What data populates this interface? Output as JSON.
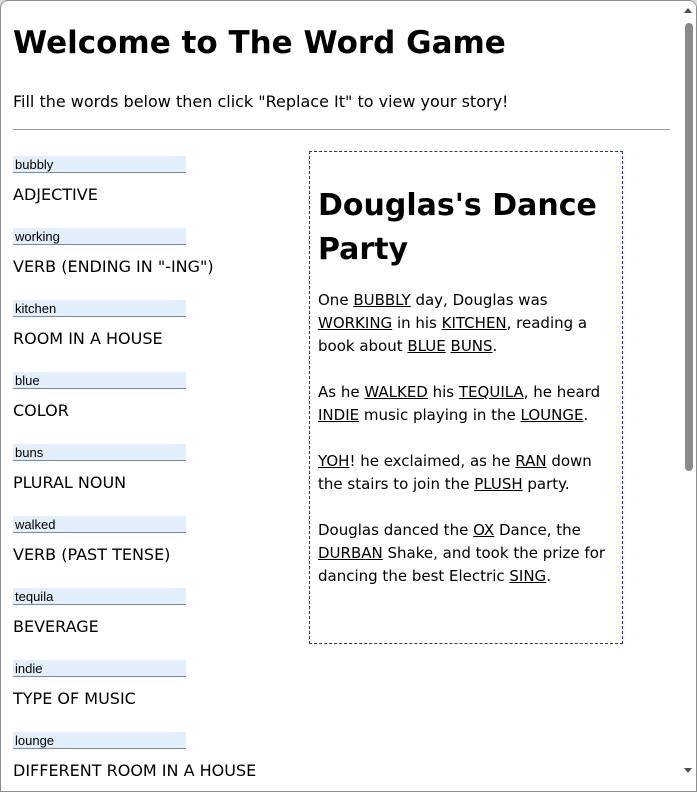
{
  "page": {
    "title": "Welcome to The Word Game",
    "intro": "Fill the words below then click \"Replace It\" to view your story!"
  },
  "fields": [
    {
      "value": "bubbly",
      "label": "ADJECTIVE"
    },
    {
      "value": "working",
      "label": "VERB (ENDING IN \"-ING\")"
    },
    {
      "value": "kitchen",
      "label": "ROOM IN A HOUSE"
    },
    {
      "value": "blue",
      "label": "COLOR"
    },
    {
      "value": "buns",
      "label": "PLURAL NOUN"
    },
    {
      "value": "walked",
      "label": "VERB (PAST TENSE)"
    },
    {
      "value": "tequila",
      "label": "BEVERAGE"
    },
    {
      "value": "indie",
      "label": "TYPE OF MUSIC"
    },
    {
      "value": "lounge",
      "label": "DIFFERENT ROOM IN A HOUSE"
    }
  ],
  "story": {
    "title": "Douglas's Dance Party",
    "p1": {
      "t1": "One ",
      "w1": "BUBBLY",
      "t2": " day, Douglas was ",
      "w2": "WORKING",
      "t3": " in his ",
      "w3": "KITCHEN",
      "t4": ", reading a book about ",
      "w4": "BLUE",
      "t5": " ",
      "w5": "BUNS",
      "t6": "."
    },
    "p2": {
      "t1": "As he ",
      "w1": "WALKED",
      "t2": " his ",
      "w2": "TEQUILA",
      "t3": ", he heard ",
      "w3": "INDIE",
      "t4": " music playing in the ",
      "w4": "LOUNGE",
      "t5": "."
    },
    "p3": {
      "w1": "YOH",
      "t1": "! he exclaimed, as he ",
      "w2": "RAN",
      "t2": " down the stairs to join the ",
      "w3": "PLUSH",
      "t3": " party."
    },
    "p4": {
      "t1": "Douglas danced the ",
      "w1": "OX",
      "t2": " Dance, the ",
      "w2": "DURBAN",
      "t3": " Shake, and took the prize for dancing the best Electric ",
      "w3": "SING",
      "t4": "."
    }
  },
  "colors": {
    "input_bg": "#e3eefb",
    "story_border": "#2a2ab8",
    "divider": "#9a9a9a"
  }
}
